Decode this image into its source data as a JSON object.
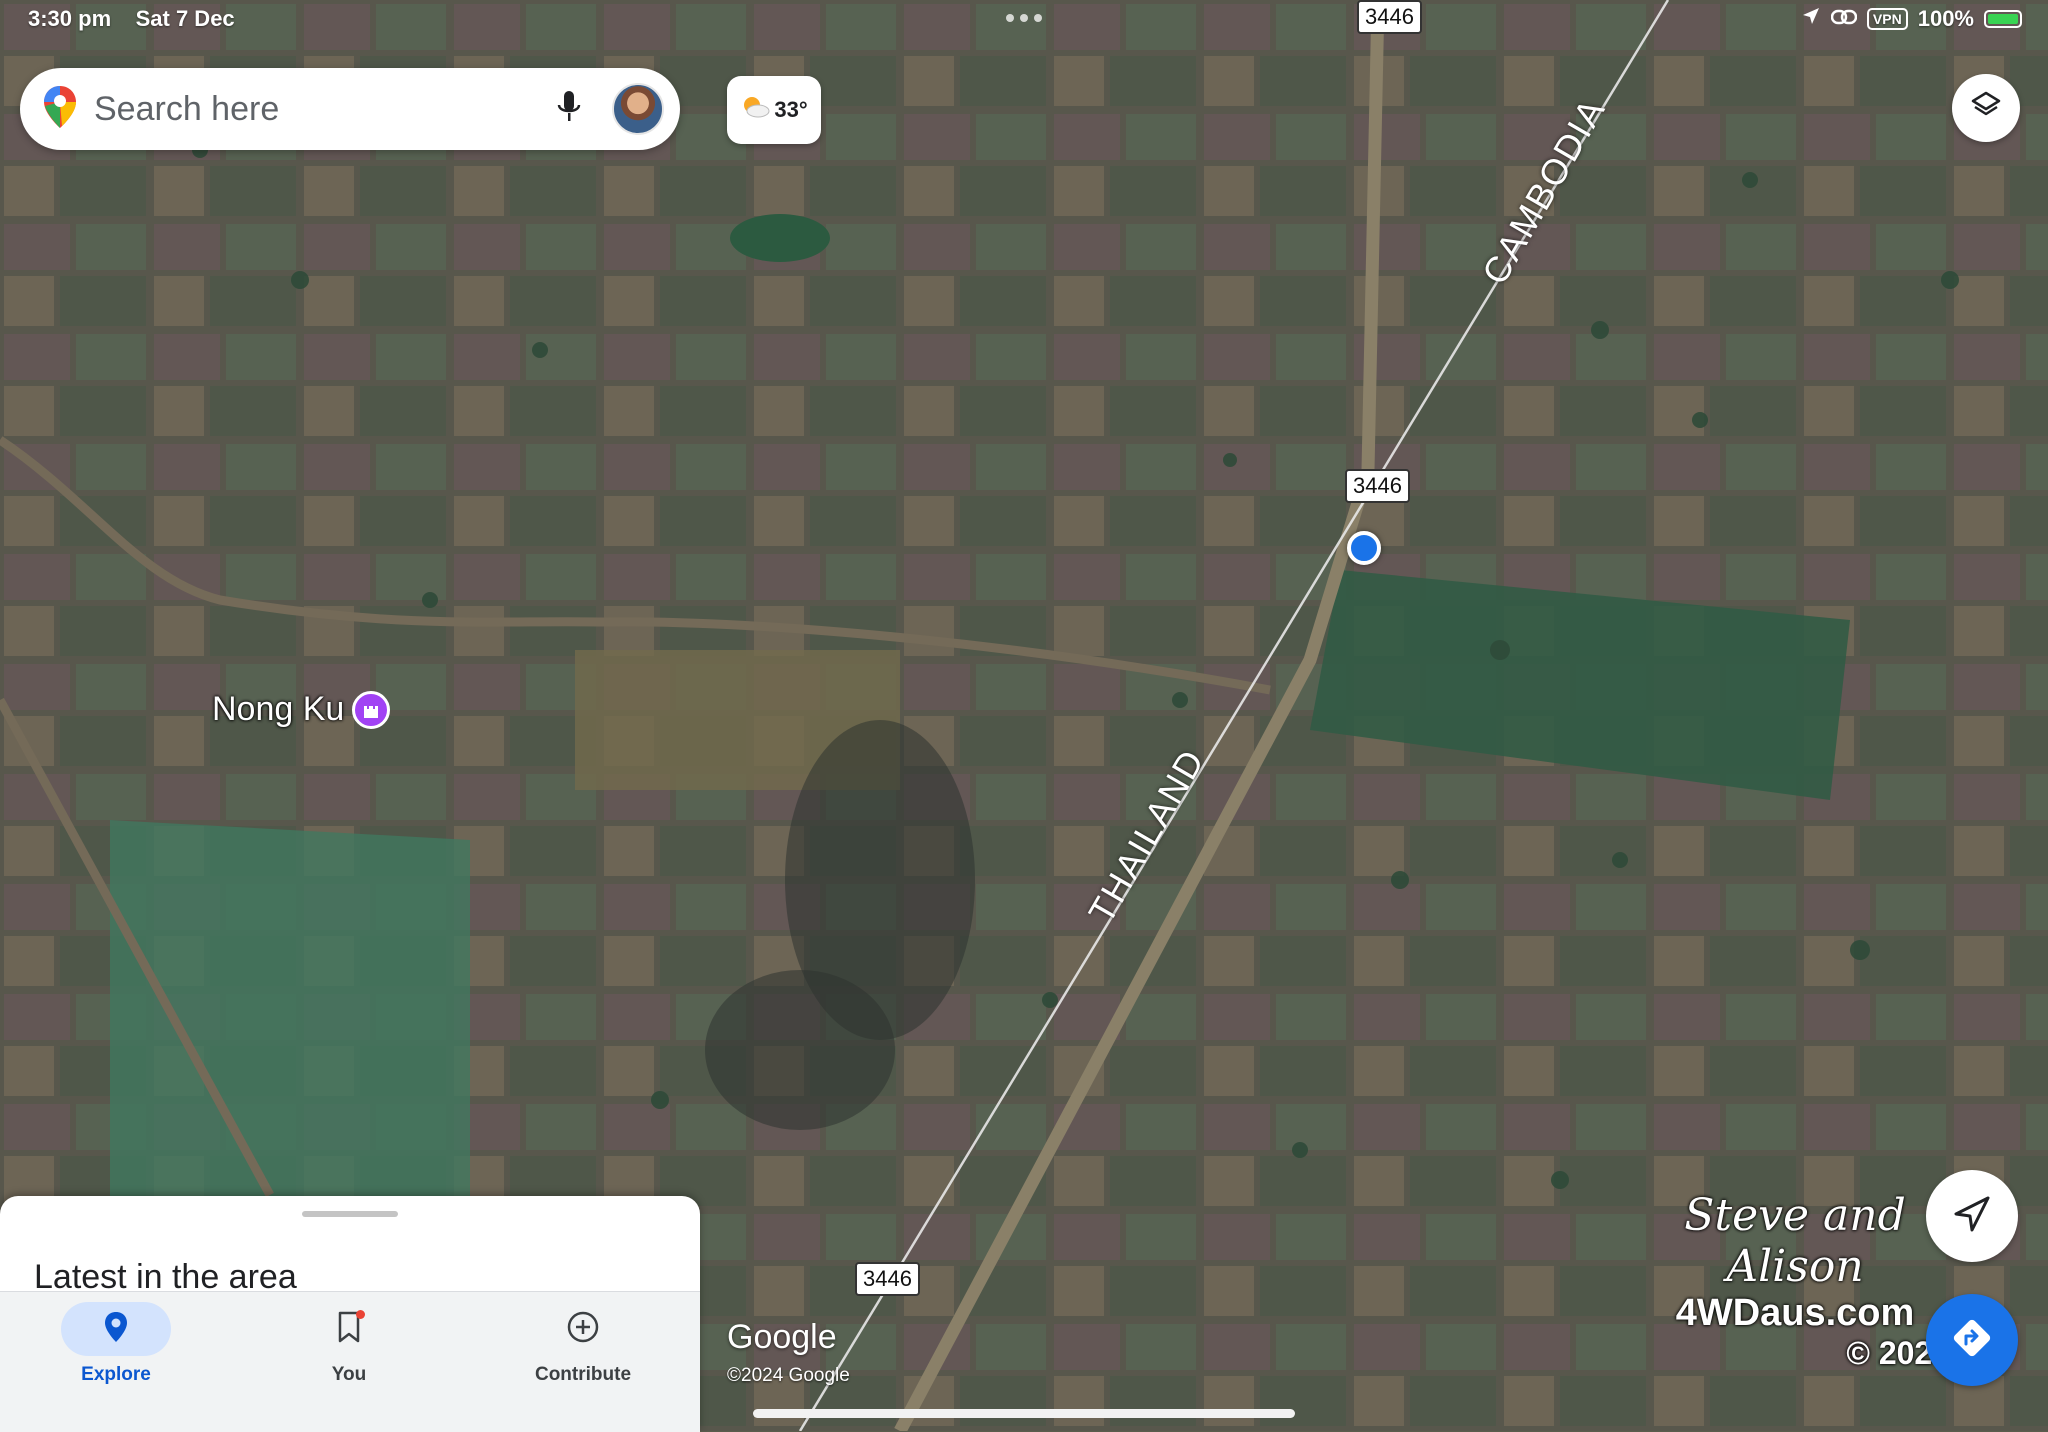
{
  "status_bar": {
    "time": "3:30 pm",
    "date": "Sat 7 Dec",
    "vpn": "VPN",
    "battery": "100%"
  },
  "search": {
    "placeholder": "Search here"
  },
  "weather": {
    "temp": "33°",
    "icon": "sun-behind-cloud-icon"
  },
  "map": {
    "type": "satellite",
    "road_shields": [
      "3446",
      "3446",
      "3446"
    ],
    "border_labels": {
      "north": "CAMBODIA",
      "south": "THAILAND"
    },
    "place": {
      "name": "Nong Ku",
      "icon": "castle-icon",
      "color": "#a142f4"
    },
    "location_dot_color": "#1a73e8",
    "attribution": {
      "logo": "Google",
      "copyright": "©2024 Google"
    }
  },
  "watermark": {
    "names": "Steve and Alison",
    "site": "4WDaus.com",
    "year": "© 2025"
  },
  "bottom_sheet": {
    "title": "Latest in the area"
  },
  "nav": {
    "explore": {
      "label": "Explore",
      "icon": "location-pin-icon"
    },
    "you": {
      "label": "You",
      "icon": "bookmark-icon"
    },
    "contribute": {
      "label": "Contribute",
      "icon": "plus-circle-icon"
    }
  },
  "colors": {
    "accent": "#1a73e8",
    "explore_active": "#0b57d0",
    "nav_active_bg": "#d3e3fd"
  }
}
